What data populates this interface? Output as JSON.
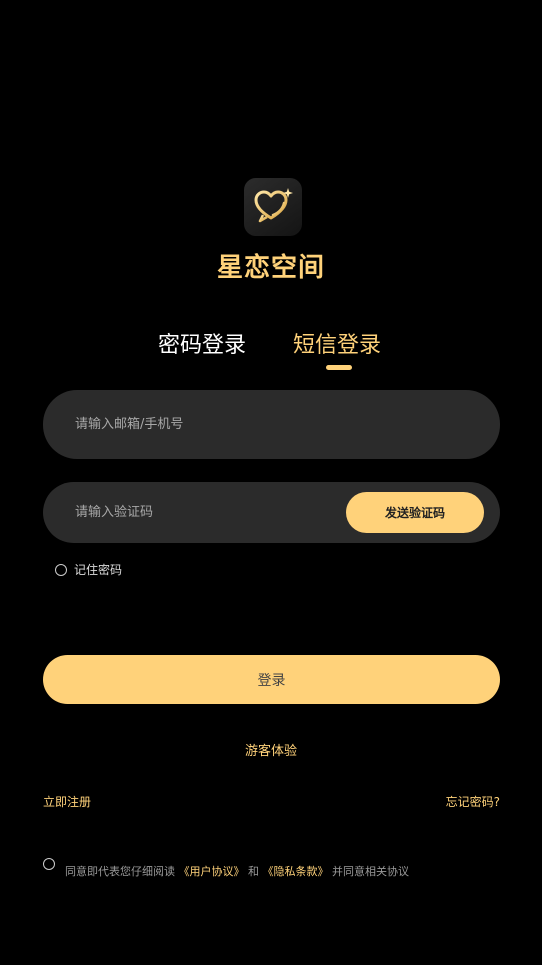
{
  "app": {
    "name": "星恋空间"
  },
  "tabs": {
    "password_login": "密码登录",
    "sms_login": "短信登录"
  },
  "form": {
    "account_placeholder": "请输入邮箱/手机号",
    "code_placeholder": "请输入验证码",
    "send_code_label": "发送验证码",
    "remember_label": "记住密码"
  },
  "actions": {
    "login_label": "登录",
    "guest_label": "游客体验",
    "register_label": "立即注册",
    "forgot_label": "忘记密码?"
  },
  "agreement": {
    "prefix": "同意即代表您仔细阅读",
    "user_agreement": "《用户协议》",
    "and": "和",
    "privacy_policy": "《隐私条款》",
    "suffix": "并同意相关协议"
  },
  "icons": {
    "app_icon": "heart-chat-sparkle-icon"
  },
  "colors": {
    "accent": "#ffd27a",
    "background": "#000000",
    "field": "#2b2b2b"
  }
}
